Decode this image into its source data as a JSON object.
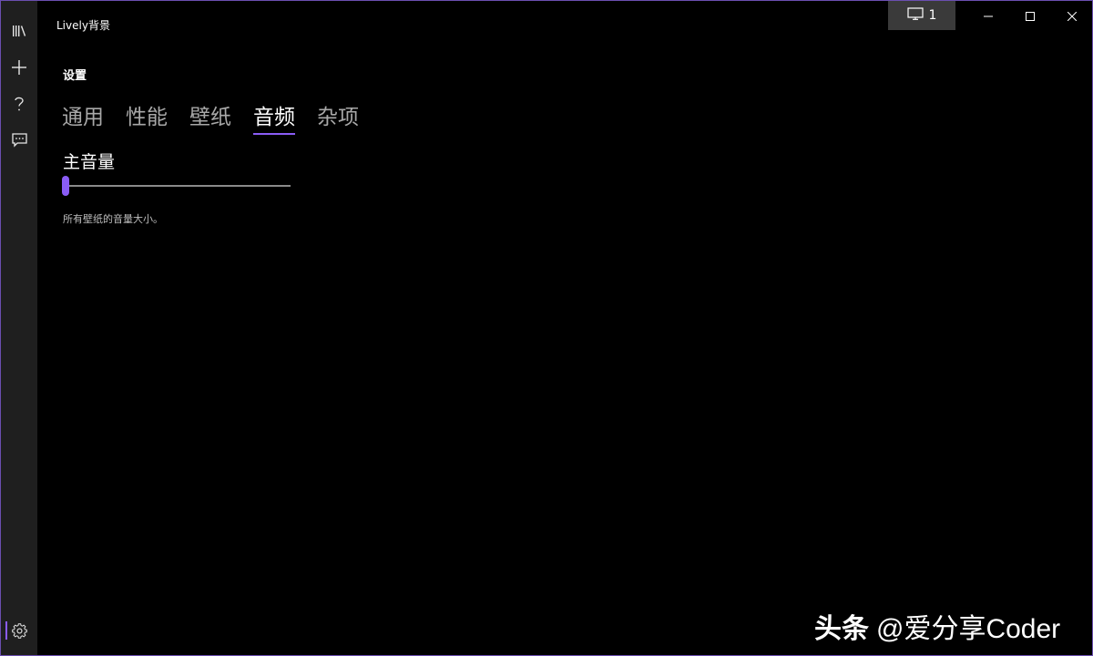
{
  "app": {
    "title": "Lively背景"
  },
  "titlebar": {
    "monitor_label": "1",
    "buttons": [
      "minimize",
      "maximize",
      "close"
    ]
  },
  "sidebar": {
    "items": [
      {
        "icon": "library-icon",
        "name": "library"
      },
      {
        "icon": "add-icon",
        "name": "add-wallpaper"
      },
      {
        "icon": "help-icon",
        "name": "help"
      },
      {
        "icon": "feedback-icon",
        "name": "feedback"
      }
    ],
    "bottom": {
      "icon": "gear-icon",
      "name": "settings",
      "active": true
    }
  },
  "page": {
    "title": "设置",
    "tabs": [
      {
        "label": "通用",
        "active": false
      },
      {
        "label": "性能",
        "active": false
      },
      {
        "label": "壁纸",
        "active": false
      },
      {
        "label": "音频",
        "active": true
      },
      {
        "label": "杂项",
        "active": false
      }
    ]
  },
  "audio": {
    "master_volume_label": "主音量",
    "master_volume_value": 0,
    "description": "所有壁纸的音量大小。"
  },
  "watermark": {
    "brand": "头条",
    "handle": "@爱分享Coder"
  },
  "colors": {
    "accent": "#8a5cf5",
    "background": "#000000",
    "sidebar": "#1f1f1f",
    "monitor_button": "#3a3a3a",
    "inactive_tab": "#a8a8a8"
  }
}
